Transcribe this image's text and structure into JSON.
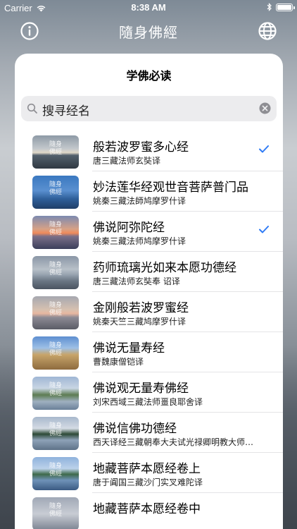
{
  "status_bar": {
    "carrier": "Carrier",
    "time": "8:38 AM"
  },
  "nav": {
    "title": "隨身佛經",
    "left_icon": "info-icon",
    "right_icon": "globe-icon"
  },
  "card": {
    "title": "学佛必读"
  },
  "search": {
    "value": "搜寻经名",
    "icon": "search-icon",
    "clear_icon": "clear-icon"
  },
  "thumb_caption": "隨身\n佛經",
  "accent_color": "#2f7bf5",
  "sutras": [
    {
      "title": "般若波罗蜜多心经",
      "translator": "唐三藏法师玄奘译",
      "checked": true
    },
    {
      "title": "妙法莲华经观世音菩萨普门品",
      "translator": "姚秦三藏法師鸠摩罗什译",
      "checked": false
    },
    {
      "title": "佛说阿弥陀经",
      "translator": "姚秦三藏法师鸠摩罗什译",
      "checked": true
    },
    {
      "title": "药师琉璃光如来本愿功德经",
      "translator": "唐三藏法师玄奘奉 诏译",
      "checked": false
    },
    {
      "title": "金刚般若波罗蜜经",
      "translator": "姚秦天竺三藏鸠摩罗什译",
      "checked": false
    },
    {
      "title": "佛说无量寿经",
      "translator": "曹魏康僧铠译",
      "checked": false
    },
    {
      "title": "佛说观无量寿佛经",
      "translator": "刘宋西域三藏法师畺良耶舍译",
      "checked": false
    },
    {
      "title": "佛说信佛功德经",
      "translator": "西天译经三藏朝奉大夫试光禄卿明教大师…",
      "checked": false
    },
    {
      "title": "地藏菩萨本愿经卷上",
      "translator": "唐于阗国三藏沙门实叉难陀译",
      "checked": false
    },
    {
      "title": "地藏菩萨本愿经卷中",
      "translator": "",
      "checked": false
    }
  ]
}
